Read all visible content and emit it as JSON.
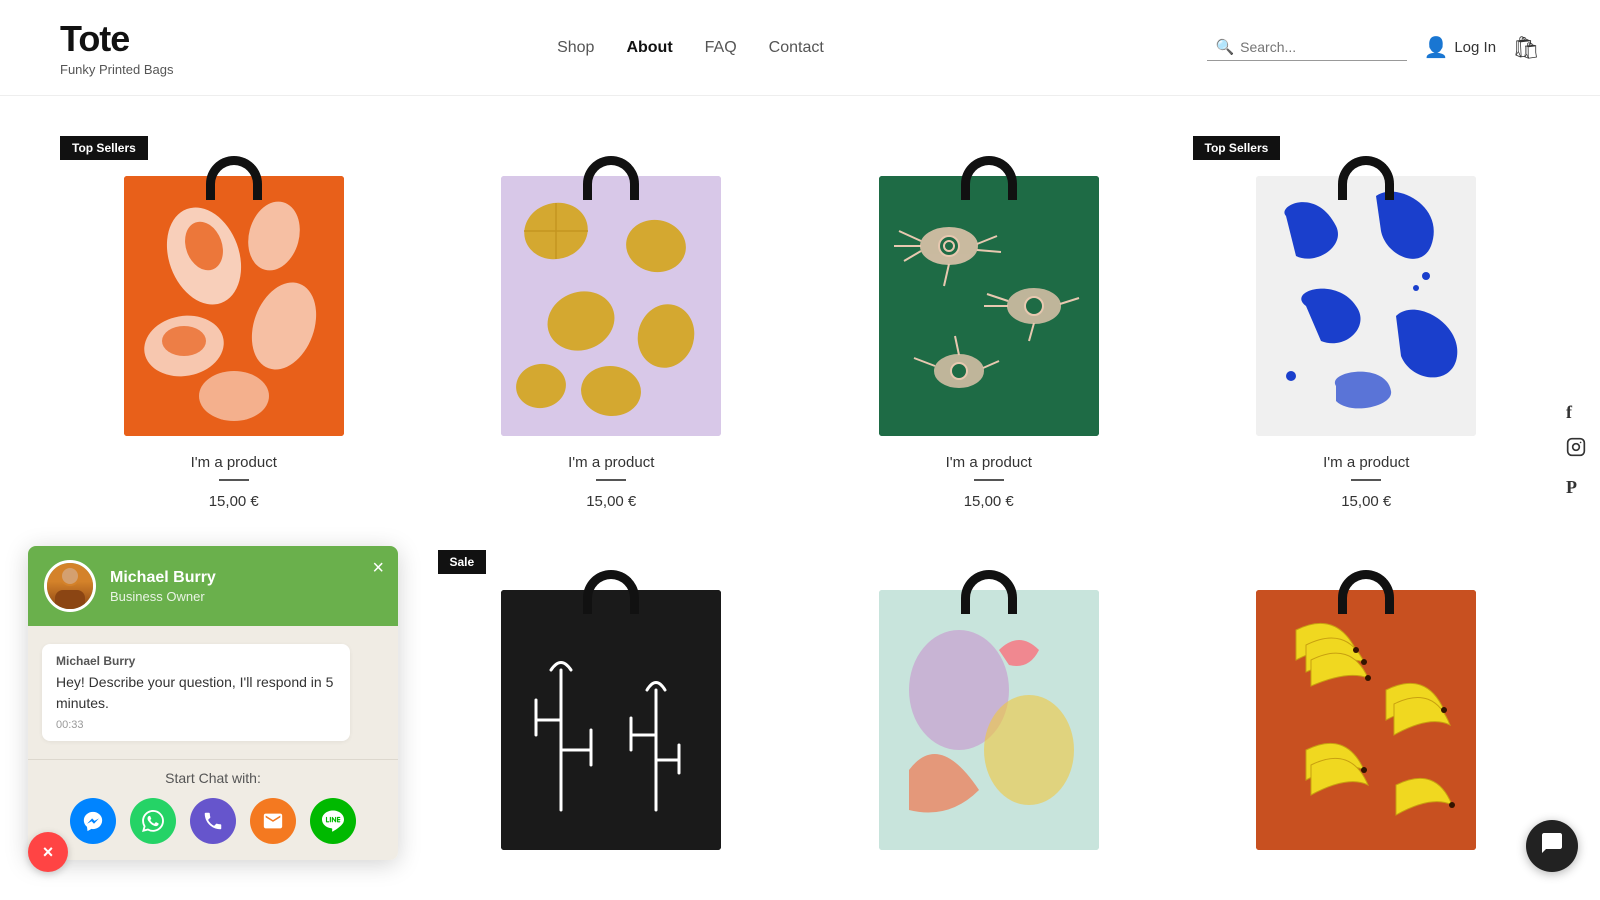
{
  "site": {
    "title": "Tote",
    "subtitle": "Funky Printed Bags"
  },
  "nav": {
    "items": [
      {
        "label": "Shop",
        "active": false
      },
      {
        "label": "About",
        "active": true
      },
      {
        "label": "FAQ",
        "active": false
      },
      {
        "label": "Contact",
        "active": false
      }
    ],
    "login_label": "Log In",
    "search_placeholder": "Search..."
  },
  "products_row1": [
    {
      "name": "I'm a product",
      "price": "15,00 €",
      "badge": "Top Sellers",
      "badge_show": true,
      "badge_type": "top",
      "color": "orange"
    },
    {
      "name": "I'm a product",
      "price": "15,00 €",
      "badge": "",
      "badge_show": false,
      "color": "lavender"
    },
    {
      "name": "I'm a product",
      "price": "15,00 €",
      "badge": "",
      "badge_show": false,
      "color": "green"
    },
    {
      "name": "I'm a product",
      "price": "15,00 €",
      "badge": "Top Sellers",
      "badge_show": true,
      "badge_type": "top",
      "color": "white-blue"
    }
  ],
  "products_row2": [
    {
      "name": "",
      "price": "",
      "badge": "Sale",
      "badge_show": true,
      "badge_type": "sale",
      "color": "black-cactus"
    },
    {
      "name": "",
      "price": "",
      "badge": "",
      "badge_show": false,
      "color": "light-animals"
    },
    {
      "name": "",
      "price": "",
      "badge": "",
      "badge_show": false,
      "color": "orange-banana"
    }
  ],
  "chat": {
    "user_name": "Michael Burry",
    "user_role": "Business Owner",
    "message_sender": "Michael Burry",
    "message_text": "Hey! Describe your question, I'll respond in 5 minutes.",
    "message_time": "00:33",
    "start_label": "Start Chat with:",
    "channels": [
      {
        "name": "Messenger",
        "class": "ch-messenger",
        "icon": "💬"
      },
      {
        "name": "WhatsApp",
        "class": "ch-whatsapp",
        "icon": "💬"
      },
      {
        "name": "Phone",
        "class": "ch-phone",
        "icon": "📞"
      },
      {
        "name": "Email",
        "class": "ch-email",
        "icon": "✉"
      },
      {
        "name": "Line",
        "class": "ch-line",
        "icon": "💬"
      }
    ],
    "close_label": "×"
  },
  "social": {
    "icons": [
      {
        "name": "Facebook",
        "symbol": "f"
      },
      {
        "name": "Instagram",
        "symbol": "⬜"
      },
      {
        "name": "Pinterest",
        "symbol": "P"
      }
    ]
  }
}
